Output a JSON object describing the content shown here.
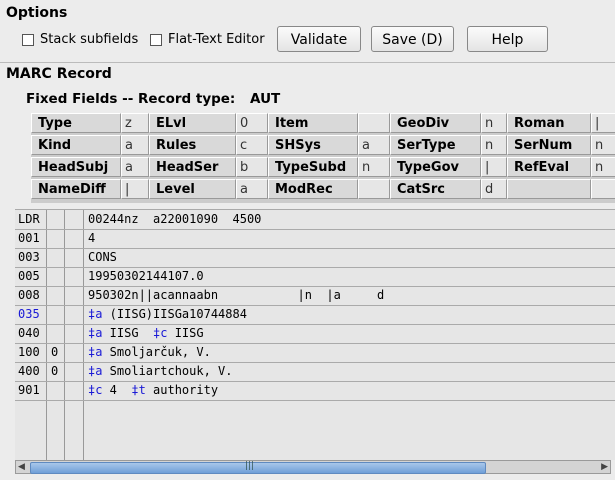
{
  "options": {
    "title": "Options",
    "stack_subfields": "Stack subfields",
    "flat_text_editor": "Flat-Text Editor",
    "validate": "Validate",
    "save": "Save (D)",
    "help": "Help"
  },
  "marc_record": {
    "title": "MARC Record",
    "fixed_title": "Fixed Fields -- Record type:",
    "record_type": "AUT",
    "fixed_fields": [
      [
        [
          "Type",
          "z"
        ],
        [
          "ELvl",
          "0"
        ],
        [
          "Item",
          ""
        ],
        [
          "GeoDiv",
          "n"
        ],
        [
          "Roman",
          "|"
        ]
      ],
      [
        [
          "Kind",
          "a"
        ],
        [
          "Rules",
          "c"
        ],
        [
          "SHSys",
          "a"
        ],
        [
          "SerType",
          "n"
        ],
        [
          "SerNum",
          "n"
        ]
      ],
      [
        [
          "HeadSubj",
          "a"
        ],
        [
          "HeadSer",
          "b"
        ],
        [
          "TypeSubd",
          "n"
        ],
        [
          "TypeGov",
          "|"
        ],
        [
          "RefEval",
          "n"
        ]
      ],
      [
        [
          "NameDiff",
          "|"
        ],
        [
          "Level",
          "a"
        ],
        [
          "ModRec",
          ""
        ],
        [
          "CatSrc",
          "d"
        ],
        [
          "",
          ""
        ]
      ]
    ],
    "fields": [
      {
        "tag": "LDR",
        "ind1": "",
        "ind2": "",
        "data": "00244nz  a22001090  4500"
      },
      {
        "tag": "001",
        "ind1": "",
        "ind2": "",
        "data": "4"
      },
      {
        "tag": "003",
        "ind1": "",
        "ind2": "",
        "data": "CONS"
      },
      {
        "tag": "005",
        "ind1": "",
        "ind2": "",
        "data": "19950302144107.0"
      },
      {
        "tag": "008",
        "ind1": "",
        "ind2": "",
        "data": "950302n||acannaabn           |n  |a     d"
      },
      {
        "tag": "035",
        "ind1": "",
        "ind2": "",
        "sub": [
          [
            "‡a",
            "(IISG)IISGa10744884"
          ]
        ]
      },
      {
        "tag": "040",
        "ind1": "",
        "ind2": "",
        "sub": [
          [
            "‡a",
            "IISG"
          ],
          [
            "‡c",
            "IISG"
          ]
        ]
      },
      {
        "tag": "100",
        "ind1": "0",
        "ind2": "",
        "sub": [
          [
            "‡a",
            "Smoljarčuk, V."
          ]
        ]
      },
      {
        "tag": "400",
        "ind1": "0",
        "ind2": "",
        "sub": [
          [
            "‡a",
            "Smoliartchouk, V."
          ]
        ]
      },
      {
        "tag": "901",
        "ind1": "",
        "ind2": "",
        "sub": [
          [
            "‡c",
            "4"
          ],
          [
            "‡t",
            "authority"
          ]
        ]
      }
    ]
  },
  "colors": {
    "subfield": "#1a1ad6",
    "scroll_thumb": "#6f9fd8"
  }
}
